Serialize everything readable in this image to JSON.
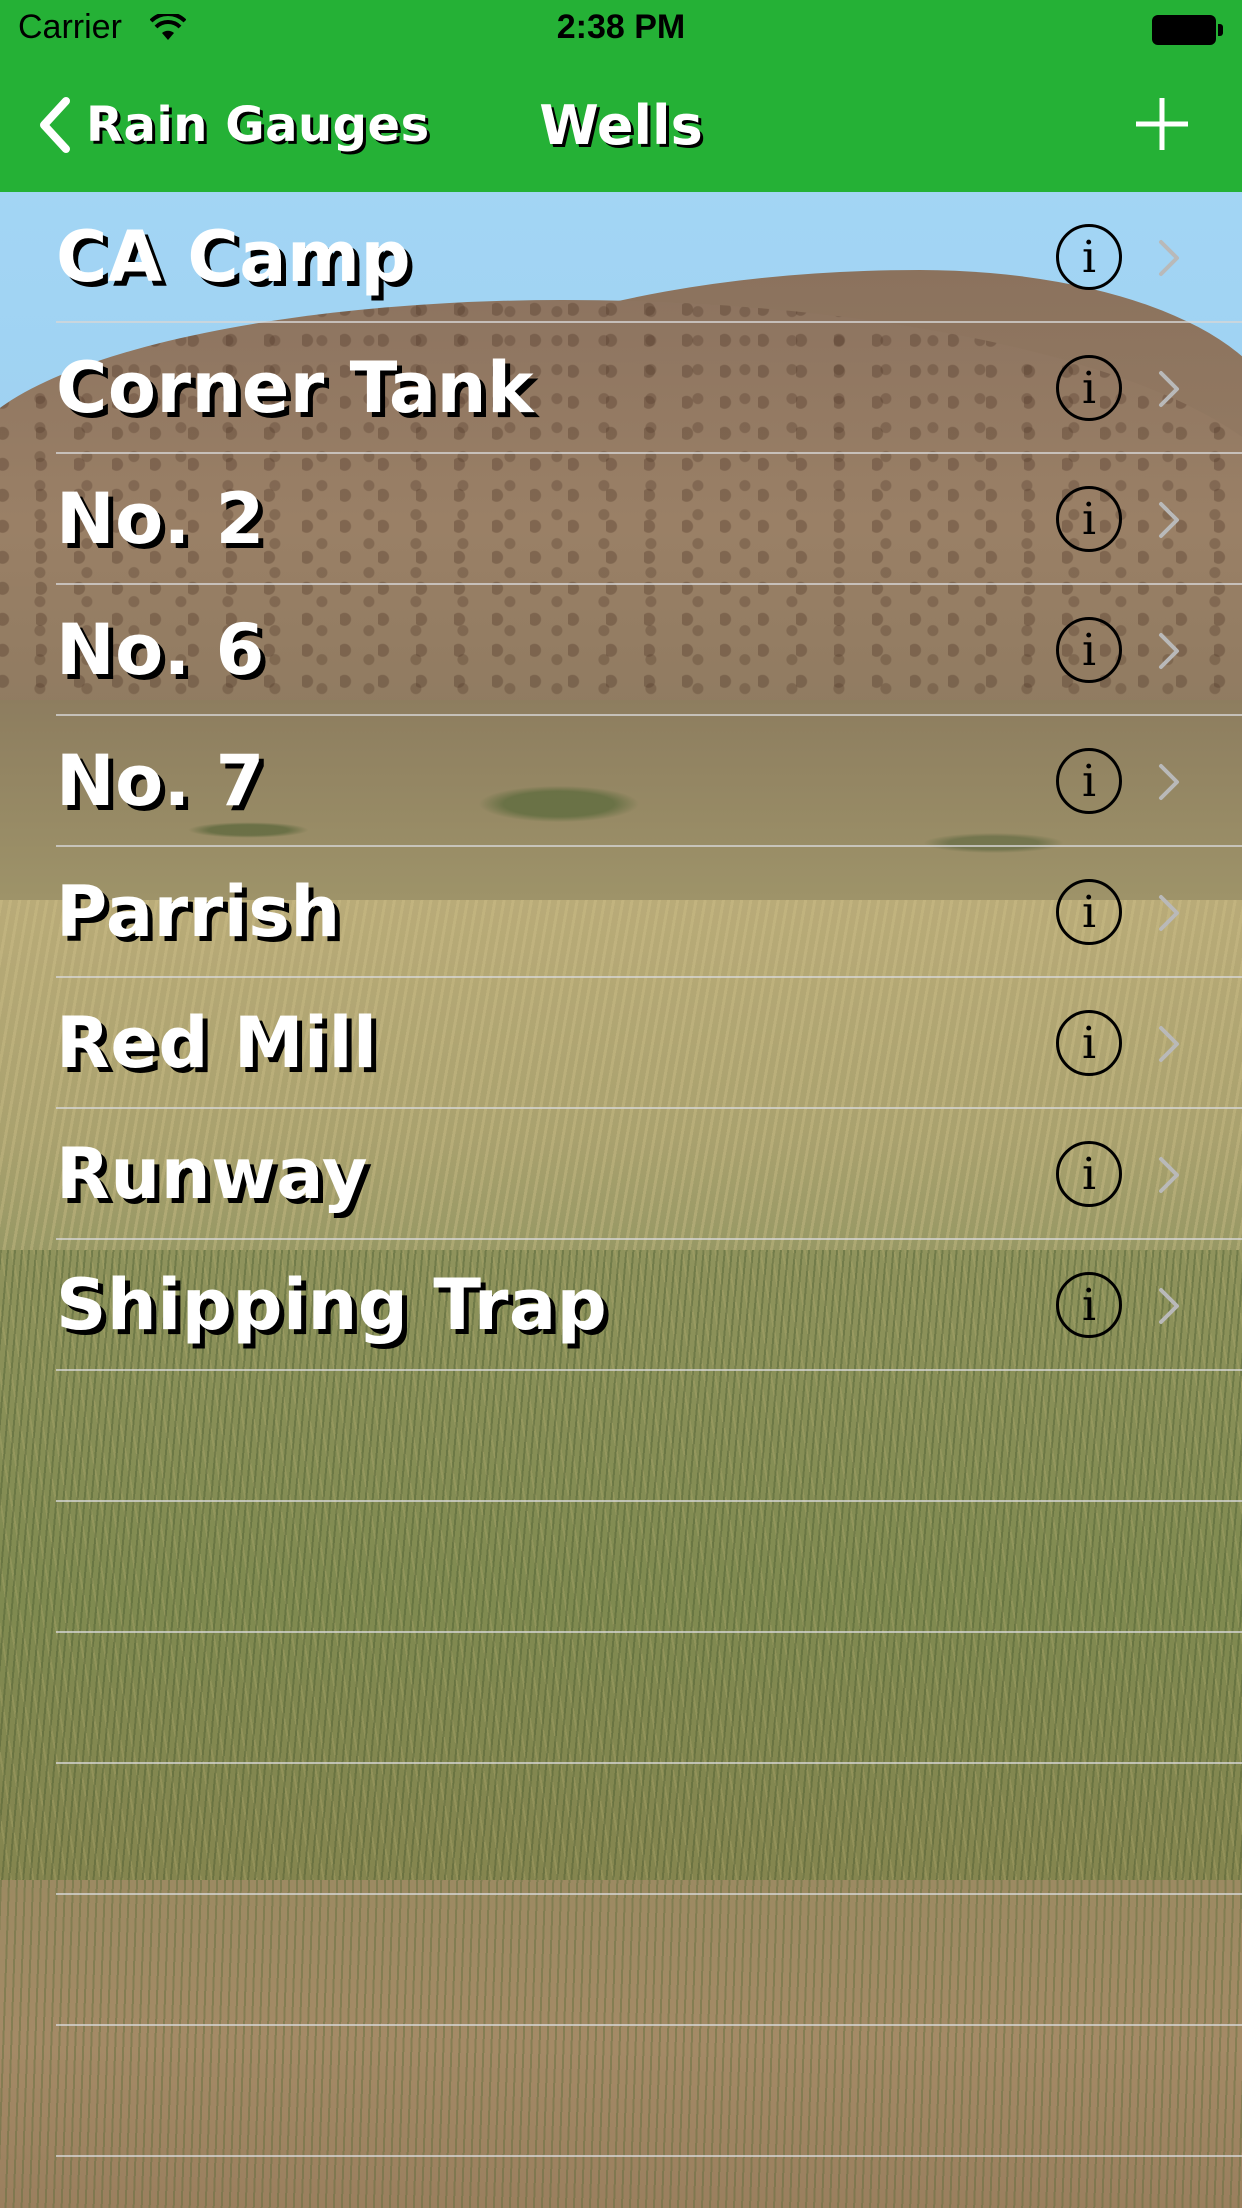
{
  "status_bar": {
    "carrier": "Carrier",
    "time": "2:38 PM"
  },
  "nav": {
    "back_label": "Rain Gauges",
    "title": "Wells",
    "add_icon": "plus-icon",
    "back_icon": "chevron-left-icon"
  },
  "colors": {
    "nav_background": "#25b136",
    "title_text": "#ffffff",
    "title_shadow": "#000000"
  },
  "wells": [
    {
      "name": "CA Camp"
    },
    {
      "name": "Corner Tank"
    },
    {
      "name": "No. 2"
    },
    {
      "name": "No. 6"
    },
    {
      "name": "No. 7"
    },
    {
      "name": "Parrish"
    },
    {
      "name": "Red Mill"
    },
    {
      "name": "Runway"
    },
    {
      "name": "Shipping Trap"
    }
  ],
  "row_icons": {
    "info": "info-icon",
    "disclosure": "chevron-right-icon"
  },
  "info_glyph": "i"
}
